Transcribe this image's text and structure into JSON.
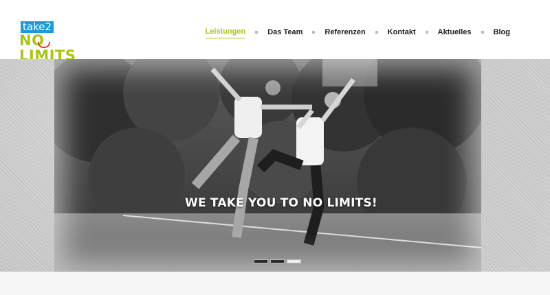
{
  "logo": {
    "line1": "take2",
    "line2": "NO LIMITS"
  },
  "nav": {
    "items": [
      {
        "label": "Leistungen",
        "active": true
      },
      {
        "label": "Das Team"
      },
      {
        "label": "Referenzen"
      },
      {
        "label": "Kontakt"
      },
      {
        "label": "Aktuelles"
      },
      {
        "label": "Blog"
      }
    ]
  },
  "hero": {
    "caption": "WE TAKE YOU TO NO LIMITS!",
    "slides_count": 3,
    "active_slide": 3
  },
  "colors": {
    "brand_green": "#a8c514",
    "brand_blue": "#1e9ad6",
    "accent_red": "#e63b2e"
  }
}
